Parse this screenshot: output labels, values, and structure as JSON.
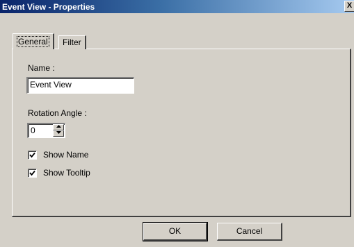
{
  "window": {
    "title": "Event View - Properties",
    "close_glyph": "X"
  },
  "tabs": [
    {
      "label": "General",
      "active": true
    },
    {
      "label": "Filter",
      "active": false
    }
  ],
  "general": {
    "name_label": "Name :",
    "name_value": "Event View",
    "rotation_label": "Rotation Angle :",
    "rotation_value": "0",
    "show_name_label": "Show Name",
    "show_name_checked": true,
    "show_tooltip_label": "Show Tooltip",
    "show_tooltip_checked": true
  },
  "buttons": {
    "ok_label": "OK",
    "cancel_label": "Cancel"
  },
  "icons": {
    "close": "close-icon",
    "spin_up": "triangle-up-icon",
    "spin_down": "triangle-down-icon",
    "check": "checkmark-icon"
  },
  "colors": {
    "title_start": "#0a246a",
    "title_end": "#a6caf0",
    "face": "#d4d0c8"
  }
}
